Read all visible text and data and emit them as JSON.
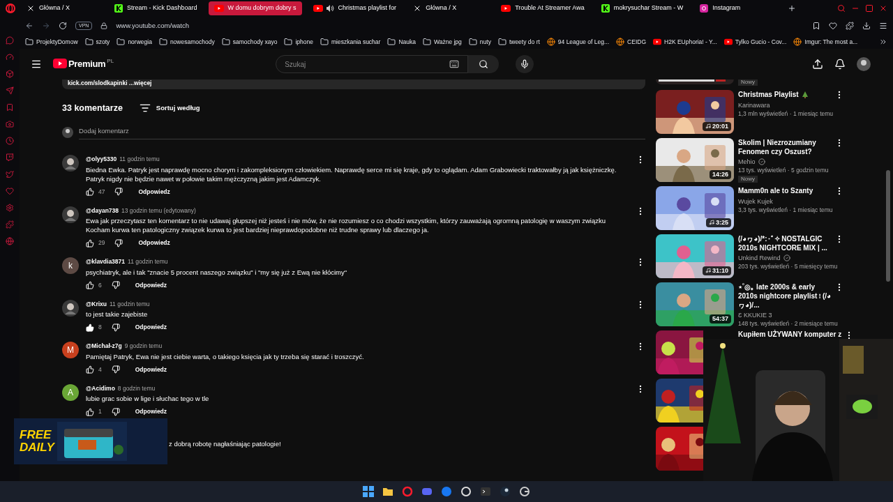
{
  "browser": {
    "tabs": [
      {
        "title": "Główna / X",
        "kind": "x",
        "selected": false
      },
      {
        "title": "Stream - Kick Dashboard",
        "kind": "kick",
        "selected": false
      },
      {
        "title": "W domu dobrym dobry s",
        "kind": "youtube",
        "selected": true
      },
      {
        "title": "Christmas playlist for",
        "kind": "youtube-audio",
        "selected": false
      },
      {
        "title": "Główna / X",
        "kind": "x",
        "selected": false
      },
      {
        "title": "Trouble At Streamer Awa",
        "kind": "youtube",
        "selected": false
      },
      {
        "title": "mokrysuchar Stream - W",
        "kind": "kick",
        "selected": false
      },
      {
        "title": "Instagram",
        "kind": "instagram",
        "selected": false
      }
    ],
    "vpn": "VPN",
    "url": "www.youtube.com/watch",
    "bookmarks": [
      {
        "label": "ProjektyDomow",
        "kind": "folder"
      },
      {
        "label": "szoty",
        "kind": "folder"
      },
      {
        "label": "norwegia",
        "kind": "folder"
      },
      {
        "label": "nowesamochody",
        "kind": "folder"
      },
      {
        "label": "samochody xayo",
        "kind": "folder"
      },
      {
        "label": "iphone",
        "kind": "folder"
      },
      {
        "label": "mieszkania suchar",
        "kind": "folder"
      },
      {
        "label": "Nauka",
        "kind": "folder"
      },
      {
        "label": "Ważne jpg",
        "kind": "folder"
      },
      {
        "label": "nuty",
        "kind": "folder"
      },
      {
        "label": "tweety do rt",
        "kind": "folder"
      },
      {
        "label": "94 League of Leg...",
        "kind": "site"
      },
      {
        "label": "CEIDG",
        "kind": "site"
      },
      {
        "label": "H2K EUphoria! - Y...",
        "kind": "youtube"
      },
      {
        "label": "Tylko Gucio - Cov...",
        "kind": "youtube"
      },
      {
        "label": "Imgur: The most a...",
        "kind": "site"
      }
    ]
  },
  "youtube": {
    "logo": "Premium",
    "region": "PL",
    "search_placeholder": "Szukaj"
  },
  "description_tail": "kick.com/slodkapinki ...więcej",
  "comments_header": {
    "count": "33 komentarze",
    "sort": "Sortuj według",
    "add_placeholder": "Dodaj komentarz"
  },
  "comments": [
    {
      "kind": "full",
      "author": "@olyy5330",
      "time": "11 godzin temu",
      "text": "Biedna Ewka. Patryk jest naprawdę mocno chorym i zakompleksionym człowiekiem. Naprawdę serce mi się kraje, gdy to oglądam. Adam Grabowiecki traktowałby ją jak księżniczkę. Patryk nigdy nie będzie nawet w połowie takim mężczyzną jakim jest Adamczyk.",
      "likes": "47",
      "liked": false,
      "reply": "Odpowiedz"
    },
    {
      "kind": "full",
      "author": "@dayan738",
      "time": "13 godzin temu (edytowany)",
      "text": "Ewa jak przeczytasz ten komentarz to nie udawaj głupszej niż jesteś i nie mów, że nie rozumiesz o co chodzi wszystkim, którzy zauważają ogromną patologię w waszym związku\nKocham kurwa ten patologiczny związek kurwa to jest bardziej nieprawdopodobne niż trudne sprawy lub dlaczego ja.",
      "likes": "29",
      "liked": false,
      "reply": "Odpowiedz"
    },
    {
      "kind": "full",
      "author": "@klavdia3871",
      "time": "11 godzin temu",
      "text": "psychiatryk, ale i tak \"znacie 5 procent naszego związku\" i \"my się już z Ewą nie kłócimy\"",
      "likes": "6",
      "liked": false,
      "reply": "Odpowiedz",
      "avatar": {
        "kind": "letter",
        "letter": "k",
        "color": "#5d4a44"
      }
    },
    {
      "kind": "full",
      "author": "@Krixu",
      "time": "11 godzin temu",
      "text": "to jest takie zajebiste",
      "likes": "8",
      "liked": true,
      "reply": "Odpowiedz"
    },
    {
      "kind": "full",
      "author": "@Michał-z7g",
      "time": "9 godzin temu",
      "text": "Pamiętaj Patryk,  Ewa nie jest ciebie warta, o takiego księcia jak ty trzeba się starać i troszczyć.",
      "likes": "4",
      "liked": false,
      "reply": "Odpowiedz",
      "avatar": {
        "kind": "letter",
        "letter": "M",
        "color": "#c8401e"
      }
    },
    {
      "kind": "full",
      "author": "@Acidimo",
      "time": "8 godzin temu",
      "text": "lubie grac sobie  w lige i słuchac tego w tle",
      "likes": "1",
      "liked": false,
      "reply": "Odpowiedz",
      "avatar": {
        "kind": "letter",
        "letter": "A",
        "color": "#6aa636"
      }
    },
    {
      "kind": "covered",
      "text": "z dobrą robotę nagłaśniając patologie!"
    }
  ],
  "related": [
    {
      "kind": "partial",
      "badge": "Nowy"
    },
    {
      "kind": "full",
      "title": "Christmas Playlist",
      "tree_icon": true,
      "channel": "Karinawara",
      "verified": false,
      "meta": "1,3 mln wyświetleń · 1 miesiąc temu",
      "duration": "20:01",
      "music": true
    },
    {
      "kind": "full",
      "title": "Skolim | Niezrozumiany Fenomen czy Oszust?",
      "tree_icon": false,
      "channel": "Mehio",
      "verified": true,
      "meta": "13 tys. wyświetleń · 5 godzin temu",
      "badge": "Nowy",
      "duration": "14:26",
      "music": false
    },
    {
      "kind": "full",
      "title": "Mamm0n ale to Szanty",
      "tree_icon": false,
      "channel": "Wujek Kujek",
      "verified": false,
      "meta": "3,3 tys. wyświetleń · 1 miesiąc temu",
      "duration": "3:25",
      "music": true
    },
    {
      "kind": "full",
      "title": "(/◕ヮ◕)/*:･ﾟ✧ NOSTALGIC 2010s NIGHTCORE MIX | ...",
      "tree_icon": false,
      "channel": "Unkind Rewind",
      "verified": true,
      "meta": "203 tys. wyświetleń · 5 miesięcy temu",
      "duration": "31:10",
      "music": true
    },
    {
      "kind": "full",
      "title": "⋆˚◎｡ late 2000s & early 2010s nightcore playlist ፧ (/◕ヮ◕)/...",
      "tree_icon": false,
      "channel": "Ɛ KKUKIE 3",
      "verified": false,
      "meta": "148 tys. wyświetleń · 2 miesiące temu",
      "duration": "54:37",
      "music": false
    },
    {
      "kind": "covered",
      "title": "Kupiłem UŻYWANY komputer z"
    },
    {
      "kind": "thumb"
    },
    {
      "kind": "thumb"
    }
  ],
  "overlay": {
    "lines": [
      "FREE",
      "DAILY"
    ]
  }
}
